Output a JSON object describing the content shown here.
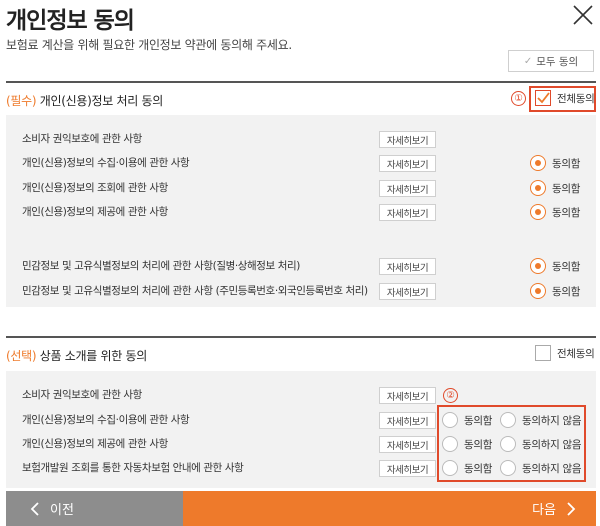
{
  "header": {
    "title": "개인정보 동의",
    "subtitle": "보험료 계산을 위해 필요한 개인정보 약관에 동의해 주세요.",
    "all_agree_label": "모두 동의"
  },
  "required_section": {
    "tag": "(필수)",
    "title": " 개인(신용)정보 처리 동의",
    "all_check_label": "전체동의",
    "all_checked": true,
    "marker": "①",
    "detail_label": "자세히보기",
    "agree_label": "동의함",
    "items": [
      {
        "label": "소비자 권익보호에 관한 사항"
      },
      {
        "label": "개인(신용)정보의 수집·이용에 관한 사항"
      },
      {
        "label": "개인(신용)정보의 조회에 관한 사항"
      },
      {
        "label": "개인(신용)정보의 제공에 관한 사항"
      },
      {
        "label": "민감정보 및 고유식별정보의 처리에 관한 사항(질병·상해정보 처리)"
      },
      {
        "label": "민감정보 및 고유식별정보의 처리에 관한 사항 (주민등록번호·외국인등록번호 처리)"
      }
    ]
  },
  "optional_section": {
    "tag": "(선택)",
    "title": " 상품 소개를 위한 동의",
    "all_check_label": "전체동의",
    "all_checked": false,
    "marker": "②",
    "detail_label": "자세히보기",
    "agree_label": "동의함",
    "disagree_label": "동의하지 않음",
    "items": [
      {
        "label": "소비자 권익보호에 관한 사항"
      },
      {
        "label": "개인(신용)정보의 수집·이용에 관한 사항"
      },
      {
        "label": "개인(신용)정보의 제공에 관한 사항"
      },
      {
        "label": "보험개발원 조회를 통한 자동차보험 안내에 관한 사항"
      }
    ]
  },
  "footer": {
    "prev_label": "이전",
    "next_label": "다음"
  },
  "colors": {
    "accent": "#ee7a2b",
    "highlight": "#e04a2b",
    "prev_button": "#8d8d8d"
  }
}
